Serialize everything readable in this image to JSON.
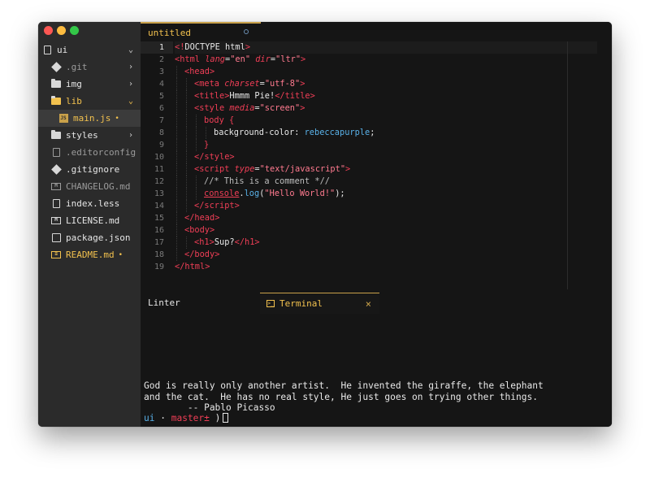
{
  "sidebar": {
    "root": {
      "label": "ui"
    },
    "items": [
      {
        "label": ".git",
        "icon": "git-icon",
        "kind": "folder",
        "style": "dim"
      },
      {
        "label": "img",
        "icon": "folder-icon",
        "kind": "folder"
      },
      {
        "label": "lib",
        "icon": "folder-icon",
        "kind": "folder",
        "expanded": true,
        "style": "gold"
      },
      {
        "label": "main.js",
        "icon": "js-file-icon",
        "kind": "file",
        "modified": true,
        "style": "gold",
        "selected": true
      },
      {
        "label": "styles",
        "icon": "folder-icon",
        "kind": "folder"
      },
      {
        "label": ".editorconfig",
        "icon": "editorconfig-icon",
        "kind": "file",
        "style": "dim"
      },
      {
        "label": ".gitignore",
        "icon": "git-icon",
        "kind": "file"
      },
      {
        "label": "CHANGELOG.md",
        "icon": "markdown-icon",
        "kind": "file",
        "style": "dim"
      },
      {
        "label": "index.less",
        "icon": "css-icon",
        "kind": "file"
      },
      {
        "label": "LICENSE.md",
        "icon": "markdown-icon",
        "kind": "file"
      },
      {
        "label": "package.json",
        "icon": "json-icon",
        "kind": "file"
      },
      {
        "label": "README.md",
        "icon": "readme-icon",
        "kind": "file",
        "modified": true,
        "style": "gold"
      }
    ],
    "modified_marker": "•",
    "chevron_right": "›",
    "chevron_down": "⌄"
  },
  "editor": {
    "tab_title": "untitled",
    "current_line": 1,
    "line_numbers": [
      "1",
      "2",
      "3",
      "4",
      "5",
      "6",
      "7",
      "8",
      "9",
      "10",
      "11",
      "12",
      "13",
      "14",
      "15",
      "16",
      "17",
      "18",
      "19"
    ]
  },
  "panel": {
    "linter_tab": "Linter",
    "terminal_tab": "Terminal",
    "close_glyph": "×"
  },
  "terminal": {
    "lines": [
      "God is really only another artist.  He invented the giraffe, the elephant",
      "and the cat.  He has no real style, He just goes on trying other things.",
      "        -- Pablo Picasso"
    ],
    "prompt_dir": "ui",
    "prompt_sep": "·",
    "prompt_branch": "master±",
    "prompt_end": ")"
  },
  "colors": {
    "accent": "#f2c14e",
    "tag": "#ef3e56",
    "value": "#59b1e8",
    "background": "#151515",
    "sidebar": "#2b2b2b"
  }
}
